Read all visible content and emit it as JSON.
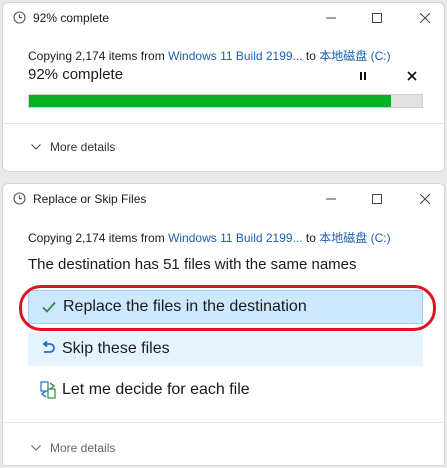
{
  "progress_dialog": {
    "title": "92% complete",
    "copy_prefix": "Copying 2,174 items from ",
    "source": "Windows 11 Build 2199...",
    "to_word": " to ",
    "destination": "本地磁盘 (C:)",
    "percent_text": "92% complete",
    "progress_value": 92,
    "more_details": "More details"
  },
  "replace_dialog": {
    "title": "Replace or Skip Files",
    "copy_prefix": "Copying 2,174 items from ",
    "source": "Windows 11 Build 2199...",
    "to_word": " to ",
    "destination": "本地磁盘 (C:)",
    "message": "The destination has 51 files with the same names",
    "options": [
      {
        "label": "Replace the files in the destination",
        "icon": "check-icon"
      },
      {
        "label": "Skip these files",
        "icon": "skip-icon"
      },
      {
        "label": "Let me decide for each file",
        "icon": "decide-icon"
      }
    ],
    "more_details": "More details"
  },
  "colors": {
    "progress_fill": "#06b025",
    "link": "#1a5fb4",
    "selected_option": "#cce8ff",
    "highlight_ring": "#e0141e"
  }
}
